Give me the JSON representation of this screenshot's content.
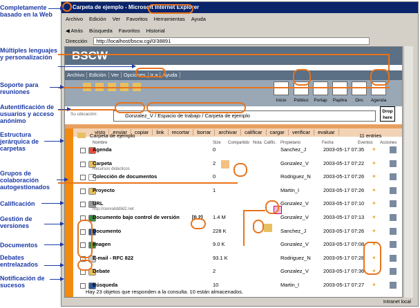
{
  "annotations": [
    "Completamente basado en la Web",
    "Múltiples lenguajes y personalización",
    "Soporte para reuniones",
    "Autentificación de usuarios y acceso anónimo",
    "Estructura jerárquica de carpetas",
    "Grupos de colaboración autogestionados",
    "Calificación",
    "Gestión de versiones",
    "Documentos",
    "Debates entrelazados",
    "Notificación de sucesos"
  ],
  "title": "Carpeta de ejemplo - Microsoft Internet Explorer",
  "menubar": [
    "Archivo",
    "Edición",
    "Ver",
    "Favoritos",
    "Herramientas",
    "Ayuda"
  ],
  "toolbar": [
    "Atrás",
    "Búsqueda",
    "Favoritos",
    "Historial"
  ],
  "address_label": "Dirección",
  "address": "http://localhost/bscw.cgi/0/38891",
  "logo": "BSCW",
  "app_menu": [
    "Archivo",
    "Edición",
    "Ver",
    "Opciones",
    "Ir a",
    "Ayuda"
  ],
  "tools": [
    "Inicio",
    "Público",
    "Portap",
    "Papltra",
    "Dirs",
    "Agenda"
  ],
  "location_label": "Su ubicación:",
  "breadcrumb": "Gonzalez_V / Espacio de trabajo / Carpeta de ejemplo",
  "drop": "Drop here",
  "actions": [
    "visto",
    "enviar",
    "copiar",
    "link",
    "recortar",
    "borrar",
    "archivar",
    "calificar",
    "cargar",
    "verificar",
    "evaluar"
  ],
  "folder": "Carpeta de ejemplo",
  "entries": "11 entries",
  "columns": [
    "Nombre",
    "Size",
    "Compartido",
    "Nota",
    "Calific.",
    "Propietario",
    "Fecha",
    "Eventos",
    "Acciones"
  ],
  "rows": [
    {
      "name": "Agenda",
      "size": "0",
      "owner": "Sanchez_J",
      "date": "2003-05-17 07:35",
      "color": "#e84f3c"
    },
    {
      "name": "Carpeta",
      "size": "2",
      "owner": "Gonzalez_V",
      "date": "2003-05-17 07:22",
      "color": "#e8c060",
      "sub": "Recursos didácticos"
    },
    {
      "name": "Colección de documentos",
      "size": "0",
      "owner": "Rodriguez_N",
      "date": "2003-05-17 07:26",
      "color": "#ffffff"
    },
    {
      "name": "Proyecto",
      "size": "1",
      "owner": "Martin_I",
      "date": "2003-05-17 07:26",
      "color": "#e8c060"
    },
    {
      "name": "URL",
      "size": "",
      "owner": "Gonzalez_V",
      "date": "2003-05-17 07:10",
      "color": "#9a9a9a",
      "sub": "http://ciervaliddlid2.net"
    },
    {
      "name": "Documento bajo control de versión",
      "ver": "[0.2]",
      "size": "1.4 M",
      "owner": "Gonzalez_V",
      "date": "2003-05-17 07:13",
      "color": "#3c8a3c"
    },
    {
      "name": "Documento",
      "size": "228 K",
      "owner": "Sanchez_J",
      "date": "2003-05-17 07:26",
      "color": "#2c5aa0"
    },
    {
      "name": "Imagen",
      "size": "9.0 K",
      "owner": "Gonzalez_V",
      "date": "2003-05-17 07:08",
      "color": "#3c8a3c"
    },
    {
      "name": "E-mail - RFC 822",
      "size": "93.1 K",
      "owner": "Rodriguez_N",
      "date": "2003-05-17 07:28",
      "color": "#cccccc"
    },
    {
      "name": "Debate",
      "size": "2",
      "owner": "Gonzalez_V",
      "date": "2003-05-17 07:36",
      "color": "#e8c060"
    },
    {
      "name": "Búsqueda",
      "size": "10",
      "owner": "Martin_I",
      "date": "2003-05-17 07:27",
      "color": "#2c5aa0"
    }
  ],
  "footer": "Hay 23 objetos que responden a la consulta. 10 están almacenados.",
  "status": "Intranet local"
}
